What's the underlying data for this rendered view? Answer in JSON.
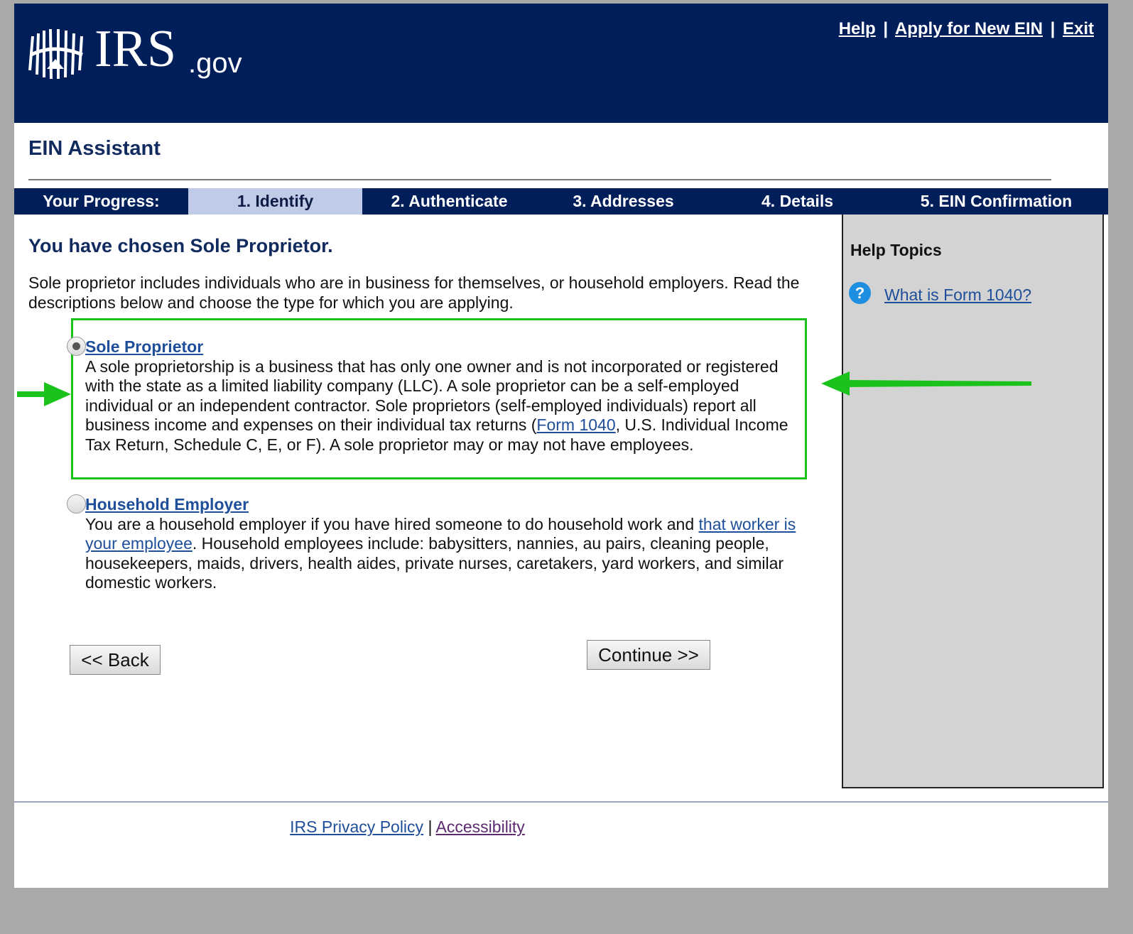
{
  "header": {
    "logo_text": "IRS",
    "logo_suffix": ".gov",
    "links": {
      "help": "Help",
      "apply": "Apply for New EIN",
      "exit": "Exit",
      "separator": "|"
    }
  },
  "app_title": "EIN Assistant",
  "progress": {
    "label": "Your Progress:",
    "steps": [
      "1. Identify",
      "2. Authenticate",
      "3. Addresses",
      "4. Details",
      "5. EIN Confirmation"
    ],
    "active_step": "1. Identify"
  },
  "main": {
    "heading": "You have chosen Sole Proprietor.",
    "intro": "Sole proprietor includes individuals who are in business for themselves, or household employers. Read the descriptions below and choose the type for which you are applying.",
    "options": [
      {
        "title": "Sole Proprietor",
        "selected": true,
        "text_before_link": "A sole proprietorship is a business that has only one owner and is not incorporated or registered with the state as a limited liability company (LLC). A sole proprietor can be a self-employed individual or an independent contractor. Sole proprietors (self-employed individuals) report all business income and expenses on their individual tax returns (",
        "link": "Form 1040",
        "text_after_link": ", U.S. Individual Income Tax Return, Schedule C, E, or F). A sole proprietor may or may not have employees."
      },
      {
        "title": "Household Employer",
        "selected": false,
        "text_before_link": "You are a household employer if you have hired someone to do household work and ",
        "link": "that worker is your employee",
        "text_after_link": ". Household employees include: babysitters, nannies, au pairs, cleaning people, housekeepers, maids, drivers, health aides, private nurses, caretakers, yard workers, and similar domestic workers."
      }
    ],
    "buttons": {
      "back": "<< Back",
      "continue": "Continue >>"
    }
  },
  "sidebar": {
    "title": "Help Topics",
    "icon": "question-circle-icon",
    "link": "What is Form 1040?"
  },
  "footer": {
    "privacy": "IRS Privacy Policy",
    "separator": "|",
    "accessibility": "Accessibility"
  },
  "colors": {
    "header_bg": "#001e5a",
    "active_step_bg": "#c0cbe8",
    "link": "#1f4f9a",
    "annotation": "#1cc21c",
    "visited_link": "#5c2a6e"
  }
}
